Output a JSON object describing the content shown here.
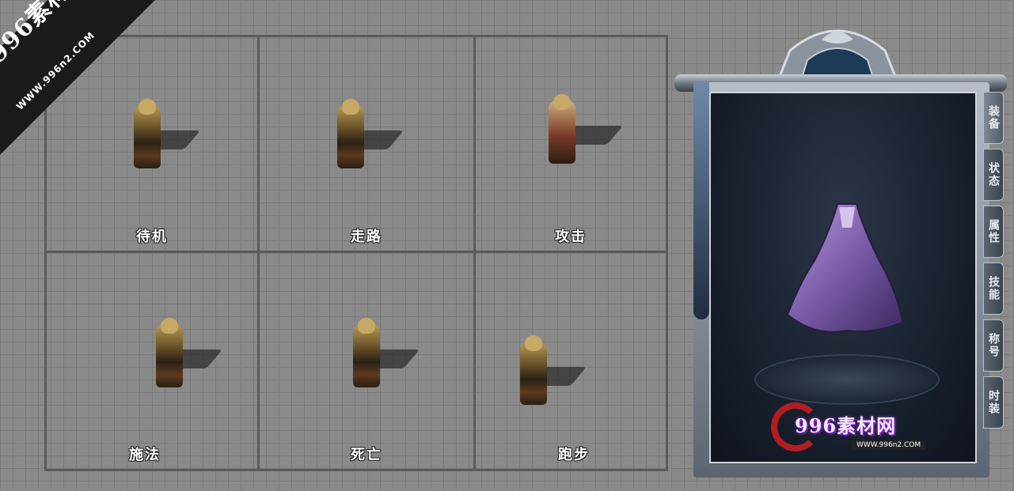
{
  "watermark": {
    "brand": "996素材网",
    "url": "WWW.996n2.COM"
  },
  "animations": [
    {
      "label": "待机"
    },
    {
      "label": "走路"
    },
    {
      "label": "攻击"
    },
    {
      "label": "施法"
    },
    {
      "label": "死亡"
    },
    {
      "label": "跑步"
    }
  ],
  "panel": {
    "item": "cloak",
    "logo_text": "996素材网",
    "logo_url": "WWW.996n2.COM",
    "tabs": [
      {
        "label": "装备",
        "active": true
      },
      {
        "label": "状态"
      },
      {
        "label": "属性"
      },
      {
        "label": "技能"
      },
      {
        "label": "称号"
      },
      {
        "label": "时装"
      }
    ]
  },
  "colors": {
    "grid_bg": "#8a8a8a",
    "cell_border": "#5a5a5a",
    "cloak": "#8e6cc0"
  }
}
